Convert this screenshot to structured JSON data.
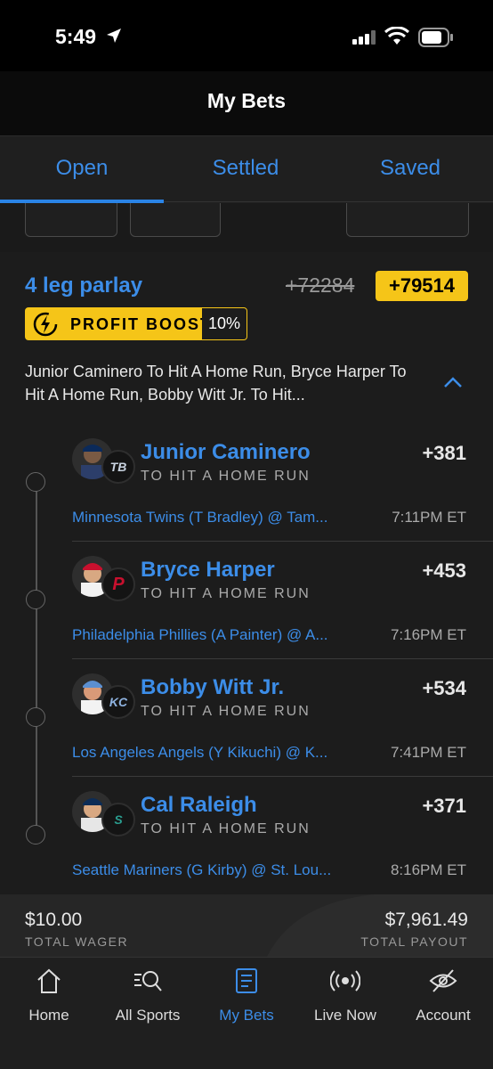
{
  "status_bar": {
    "time": "5:49"
  },
  "header": {
    "title": "My Bets"
  },
  "tabs": [
    {
      "label": "Open",
      "active": true
    },
    {
      "label": "Settled",
      "active": false
    },
    {
      "label": "Saved",
      "active": false
    }
  ],
  "bet": {
    "title": "4 leg parlay",
    "original_odds": "+72284",
    "boosted_odds": "+79514",
    "boost_label": "PROFIT BOOST",
    "boost_pct": "10%",
    "summary": "Junior Caminero To Hit A Home Run, Bryce Harper To Hit A Home Run, Bobby Witt Jr. To Hit...",
    "legs": [
      {
        "player": "Junior Caminero",
        "market": "TO HIT A HOME RUN",
        "odds": "+381",
        "game": "Minnesota Twins (T Bradley) @ Tam...",
        "time": "7:11PM ET",
        "team_logo": "TB",
        "team_color": "#0b2a5a"
      },
      {
        "player": "Bryce Harper",
        "market": "TO HIT A HOME RUN",
        "odds": "+453",
        "game": "Philadelphia Phillies (A Painter) @ A...",
        "time": "7:16PM ET",
        "team_logo": "P",
        "team_color": "#c8102e"
      },
      {
        "player": "Bobby Witt Jr.",
        "market": "TO HIT A HOME RUN",
        "odds": "+534",
        "game": "Los Angeles Angels (Y Kikuchi) @ K...",
        "time": "7:41PM ET",
        "team_logo": "KC",
        "team_color": "#5b8fd0"
      },
      {
        "player": "Cal Raleigh",
        "market": "TO HIT A HOME RUN",
        "odds": "+371",
        "game": "Seattle Mariners (G Kirby) @ St. Lou...",
        "time": "8:16PM ET",
        "team_logo": "S",
        "team_color": "#005c5c"
      }
    ],
    "total_wager": "$10.00",
    "total_wager_label": "TOTAL WAGER",
    "total_payout": "$7,961.49",
    "total_payout_label": "TOTAL PAYOUT"
  },
  "bottom_nav": [
    {
      "label": "Home",
      "icon": "home-icon",
      "active": false
    },
    {
      "label": "All Sports",
      "icon": "search-sports-icon",
      "active": false
    },
    {
      "label": "My Bets",
      "icon": "bet-slip-icon",
      "active": true
    },
    {
      "label": "Live Now",
      "icon": "live-broadcast-icon",
      "active": false
    },
    {
      "label": "Account",
      "icon": "eye-off-icon",
      "active": false
    }
  ],
  "colors": {
    "accent": "#3c8de8",
    "boost": "#f5c518",
    "background": "#1c1c1c"
  }
}
